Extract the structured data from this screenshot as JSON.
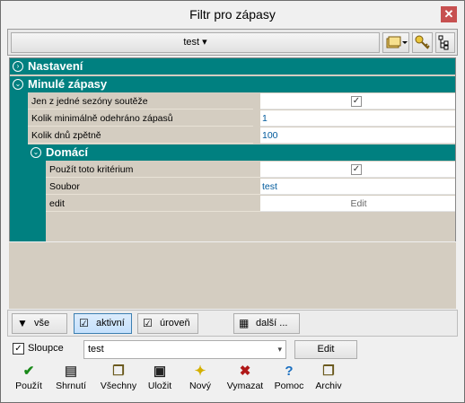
{
  "window": {
    "title": "Filtr pro zápasy",
    "close": "✕"
  },
  "topbar": {
    "selector_label": "test ▾"
  },
  "tree": {
    "section_settings": "Nastavení",
    "section_past": "Minulé zápasy",
    "rows": [
      {
        "label": "Jen z jedné sezóny soutěže",
        "value": "✓"
      },
      {
        "label": "Kolik minimálně odehráno zápasů",
        "value": "1"
      },
      {
        "label": "Kolik dnů zpětně",
        "value": "100"
      }
    ],
    "section_home": "Domácí",
    "home_rows": [
      {
        "label": "Použít toto kritérium",
        "value": "✓"
      },
      {
        "label": "Soubor",
        "value": "test"
      },
      {
        "label": "edit",
        "value": "Edit"
      }
    ]
  },
  "filter": {
    "all": "vše",
    "active": "aktivní",
    "level": "úroveň",
    "more": "další ..."
  },
  "columns": {
    "checkbox_label": "Sloupce",
    "checked": "✓",
    "combo_value": "test",
    "edit": "Edit"
  },
  "actions": [
    {
      "label": "Použít",
      "icon": "✔",
      "color": "#1a8a1a"
    },
    {
      "label": "Shrnutí",
      "icon": "▤",
      "color": "#444444"
    },
    {
      "label": "Všechny",
      "icon": "❐",
      "color": "#6b5a1e"
    },
    {
      "label": "Uložit",
      "icon": "▣",
      "color": "#222222"
    },
    {
      "label": "Nový",
      "icon": "✦",
      "color": "#d4b000"
    },
    {
      "label": "Vymazat",
      "icon": "✖",
      "color": "#b01818"
    },
    {
      "label": "Pomoc",
      "icon": "?",
      "color": "#1a6fc0"
    },
    {
      "label": "Archiv",
      "icon": "❐",
      "color": "#6b5a1e"
    }
  ]
}
